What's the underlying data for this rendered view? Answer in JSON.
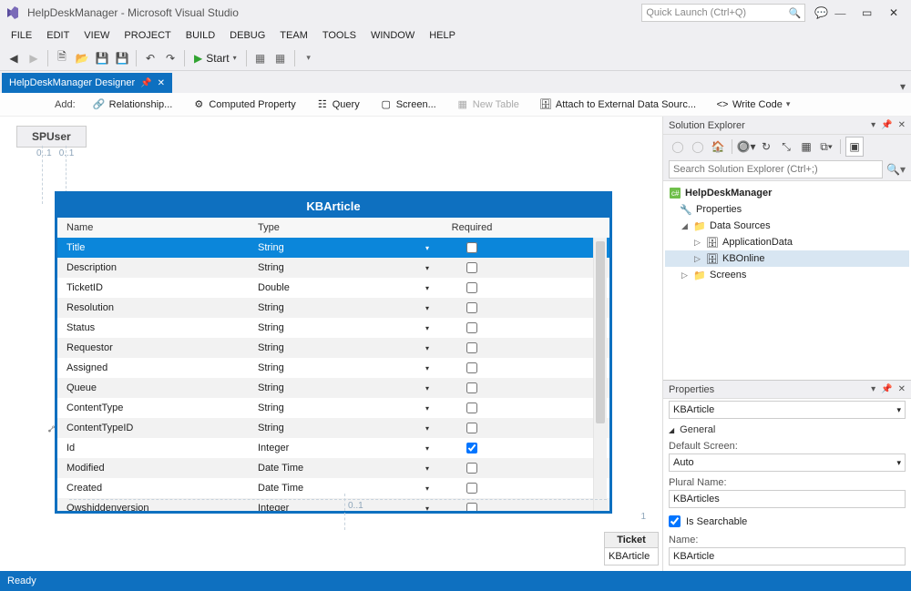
{
  "window": {
    "title": "HelpDeskManager - Microsoft Visual Studio",
    "quick_launch_placeholder": "Quick Launch (Ctrl+Q)"
  },
  "menu": [
    "FILE",
    "EDIT",
    "VIEW",
    "PROJECT",
    "BUILD",
    "DEBUG",
    "TEAM",
    "TOOLS",
    "WINDOW",
    "HELP"
  ],
  "toolbar": {
    "start_label": "Start"
  },
  "tab": {
    "label": "HelpDeskManager Designer"
  },
  "designer_bar": {
    "add_label": "Add:",
    "relationship": "Relationship...",
    "computed": "Computed Property",
    "query": "Query",
    "screen": "Screen...",
    "new_table": "New Table",
    "attach": "Attach to External Data Sourc...",
    "write_code": "Write Code"
  },
  "canvas": {
    "spuser": "SPUser",
    "entity_title": "KBArticle",
    "cols": {
      "name": "Name",
      "type": "Type",
      "required": "Required"
    },
    "rows": [
      {
        "name": "Title",
        "type": "String",
        "required": false,
        "selected": true
      },
      {
        "name": "Description",
        "type": "String",
        "required": false
      },
      {
        "name": "TicketID",
        "type": "Double",
        "required": false
      },
      {
        "name": "Resolution",
        "type": "String",
        "required": false
      },
      {
        "name": "Status",
        "type": "String",
        "required": false
      },
      {
        "name": "Requestor",
        "type": "String",
        "required": false
      },
      {
        "name": "Assigned",
        "type": "String",
        "required": false
      },
      {
        "name": "Queue",
        "type": "String",
        "required": false
      },
      {
        "name": "ContentType",
        "type": "String",
        "required": false
      },
      {
        "name": "ContentTypeID",
        "type": "String",
        "required": false
      },
      {
        "name": "Id",
        "type": "Integer",
        "required": true
      },
      {
        "name": "Modified",
        "type": "Date Time",
        "required": false
      },
      {
        "name": "Created",
        "type": "Date Time",
        "required": false
      },
      {
        "name": "Owshiddenversion",
        "type": "Integer",
        "required": false
      }
    ],
    "rel01a": "0..1",
    "rel01b": "0..1",
    "rel01c": "0..1",
    "rel1": "1",
    "ticket_hdr": "Ticket",
    "ticket_body": "KBArticle"
  },
  "solution_explorer": {
    "title": "Solution Explorer",
    "search_placeholder": "Search Solution Explorer (Ctrl+;)",
    "root": "HelpDeskManager",
    "properties": "Properties",
    "data_sources": "Data Sources",
    "app_data": "ApplicationData",
    "kbonline": "KBOnline",
    "screens": "Screens"
  },
  "properties": {
    "title": "Properties",
    "object": "KBArticle",
    "group_general": "General",
    "default_screen_label": "Default Screen:",
    "default_screen_value": "Auto",
    "plural_name_label": "Plural Name:",
    "plural_name_value": "KBArticles",
    "is_searchable_label": "Is Searchable",
    "is_searchable_checked": true,
    "name_label": "Name:",
    "name_value": "KBArticle"
  },
  "status": {
    "ready": "Ready"
  }
}
